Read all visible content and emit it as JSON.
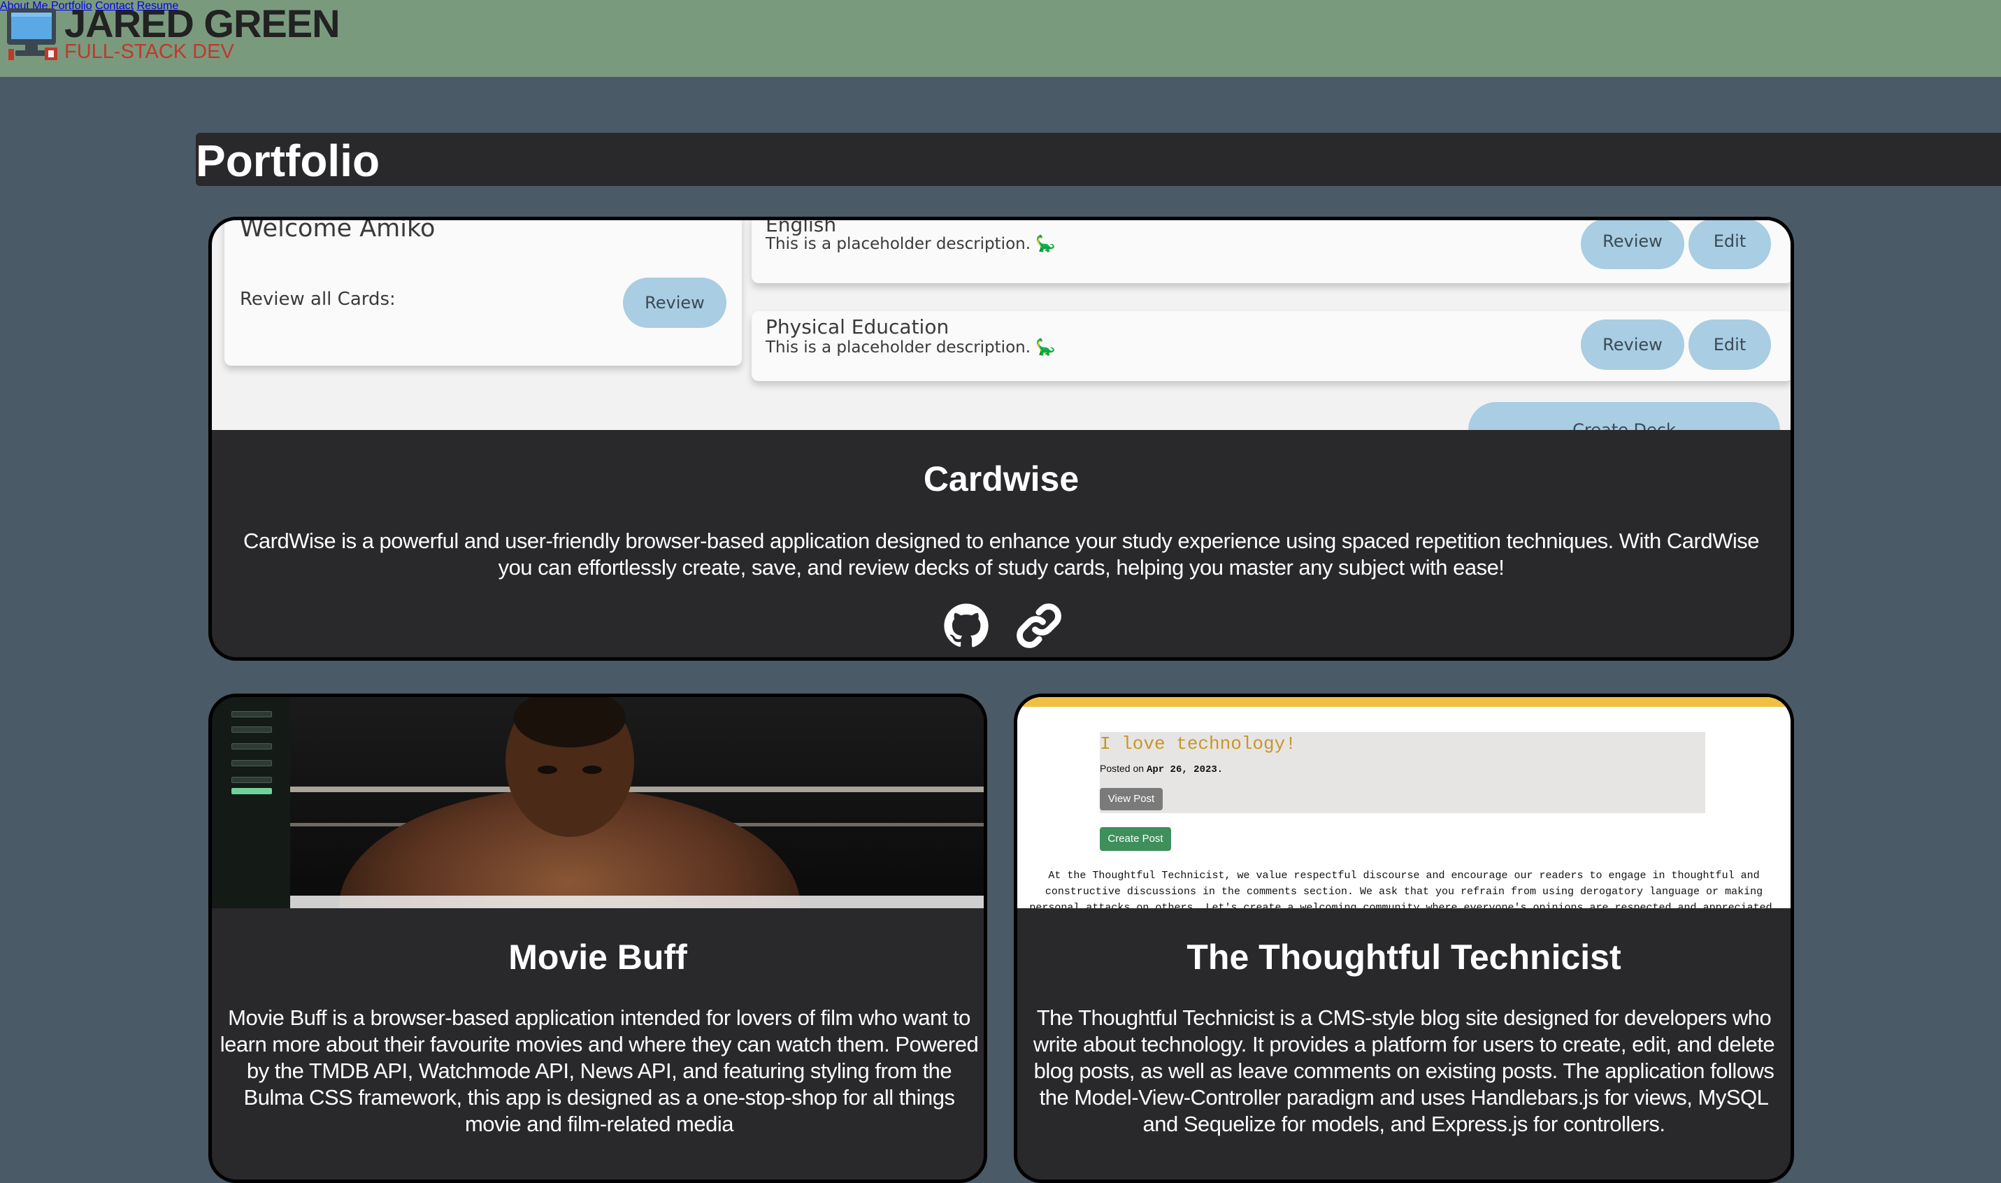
{
  "header": {
    "brand_name": "JARED GREEN",
    "brand_sub": "FULL-STACK DEV",
    "nav": [
      "About Me",
      "Portfolio",
      "Contact",
      "Resume"
    ]
  },
  "section_title": "Portfolio",
  "projects": [
    {
      "title": "Cardwise",
      "description": "CardWise is a powerful and user-friendly browser-based application designed to enhance your study experience using spaced repetition techniques. With CardWise you can effortlessly create, save, and review decks of study cards, helping you master any subject with ease!",
      "screenshot": {
        "welcome": "Welcome Amiko",
        "review_all_label": "Review all Cards:",
        "review_label": "Review",
        "edit_label": "Edit",
        "create_deck_label": "Create Deck",
        "decks": [
          {
            "name": "English",
            "description": "This is a placeholder description. 🦕"
          },
          {
            "name": "Physical Education",
            "description": "This is a placeholder description. 🦕"
          }
        ]
      }
    },
    {
      "title": "Movie Buff",
      "description": "Movie Buff is a browser-based application intended for lovers of film who want to learn more about their favourite movies and where they can watch them. Powered by the TMDB API, Watchmode API, News API, and featuring styling from the Bulma CSS framework, this app is designed as a one-stop-shop for all things movie and film-related media"
    },
    {
      "title": "The Thoughtful Technicist",
      "description": "The Thoughtful Technicist is a CMS-style blog site designed for developers who write about technology. It provides a platform for users to create, edit, and delete blog posts, as well as leave comments on existing posts. The application follows the Model-View-Controller paradigm and uses Handlebars.js for views, MySQL and Sequelize for models, and Express.js for controllers.",
      "screenshot": {
        "post_title": "I love technology!",
        "posted_on": "Posted on",
        "post_date": "Apr 26, 2023.",
        "view_post": "View Post",
        "create_post": "Create Post",
        "notice": "At the Thoughtful Technicist, we value respectful discourse and encourage our readers to engage in thoughtful and constructive discussions in the comments section. We ask that you refrain from using derogatory language or making personal attacks on others. Let's create a welcoming community where everyone's opinions are respected and appreciated."
      }
    }
  ],
  "icons": {
    "github": "github-icon",
    "link": "link-icon",
    "logo": "computer-monitor-icon"
  },
  "colors": {
    "header_bg": "#7a9a7e",
    "page_bg": "#4a5a66",
    "card_bg": "#29282b",
    "pill": "#a9cde2",
    "accent_red": "#c0392b"
  }
}
